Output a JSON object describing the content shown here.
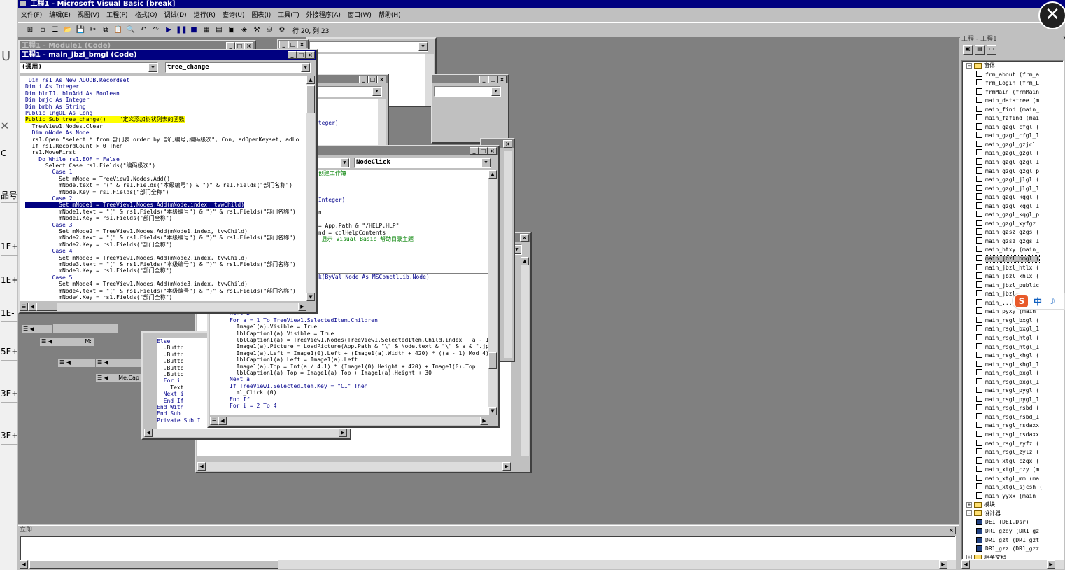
{
  "app": {
    "title": "工程1 - Microsoft Visual Basic [break]"
  },
  "menu": [
    "文件(F)",
    "编辑(E)",
    "视图(V)",
    "工程(P)",
    "格式(O)",
    "调试(D)",
    "运行(R)",
    "查询(U)",
    "图表(I)",
    "工具(T)",
    "外接程序(A)",
    "窗口(W)",
    "帮助(H)"
  ],
  "toolbar": {
    "position": "行 20, 列 23"
  },
  "module_win": {
    "title": "工程1 - Module1 (Code)"
  },
  "code_win": {
    "title": "工程1 - main_jbzl_bmgl (Code)",
    "object_combo": "(通用)",
    "proc_combo": "tree_change",
    "lines": [
      {
        "t": " Dim rs1 As New ADODB.Recordset",
        "c": "kw"
      },
      {
        "t": "Dim i As Integer",
        "c": "kw"
      },
      {
        "t": "Dim blnTJ, blnAdd As Boolean",
        "c": "kw"
      },
      {
        "t": "Dim bmjc As Integer",
        "c": "kw"
      },
      {
        "t": "Dim bmbh As String",
        "c": "kw"
      },
      {
        "t": "Public lngOL As Long",
        "c": "kw"
      },
      {
        "t": "Public Sub tree_change()    '定义添加树状列表的函数",
        "c": "hl"
      },
      {
        "t": "  TreeView1.Nodes.Clear",
        "c": ""
      },
      {
        "t": "  Dim mNode As Node",
        "c": "kw"
      },
      {
        "t": "  rs1.Open \"select * from 部门表 order by 部门编号,编码级次\", Cnn, adOpenKeyset, adLo",
        "c": ""
      },
      {
        "t": "  If rs1.RecordCount > 0 Then",
        "c": ""
      },
      {
        "t": "  rs1.MoveFirst",
        "c": ""
      },
      {
        "t": "    Do While rs1.EOF = False",
        "c": "kw"
      },
      {
        "t": "      Select Case rs1.Fields(\"编码级次\")",
        "c": ""
      },
      {
        "t": "        Case 1",
        "c": "kw"
      },
      {
        "t": "          Set mNode = TreeView1.Nodes.Add()",
        "c": ""
      },
      {
        "t": "          mNode.text = \"(\" & rs1.Fields(\"本级编号\") & \")\" & rs1.Fields(\"部门名称\")",
        "c": ""
      },
      {
        "t": "          mNode.Key = rs1.Fields(\"部门全称\")",
        "c": ""
      },
      {
        "t": "        Case 2",
        "c": "kw"
      },
      {
        "t": "          Set mNode1 = TreeView1.Nodes.Add(mNode.index, tvwChild)",
        "c": "sel"
      },
      {
        "t": "          mNode1.text = \"(\" & rs1.Fields(\"本级编号\") & \")\" & rs1.Fields(\"部门名称\")",
        "c": ""
      },
      {
        "t": "          mNode1.Key = rs1.Fields(\"部门全称\")",
        "c": ""
      },
      {
        "t": "        Case 3",
        "c": "kw"
      },
      {
        "t": "          Set mNode2 = TreeView1.Nodes.Add(mNode1.index, tvwChild)",
        "c": ""
      },
      {
        "t": "          mNode2.text = \"(\" & rs1.Fields(\"本级编号\") & \")\" & rs1.Fields(\"部门名称\")",
        "c": ""
      },
      {
        "t": "          mNode2.Key = rs1.Fields(\"部门全称\")",
        "c": ""
      },
      {
        "t": "        Case 4",
        "c": "kw"
      },
      {
        "t": "          Set mNode3 = TreeView1.Nodes.Add(mNode2.index, tvwChild)",
        "c": ""
      },
      {
        "t": "          mNode3.text = \"(\" & rs1.Fields(\"本级编号\") & \")\" & rs1.Fields(\"部门名称\")",
        "c": ""
      },
      {
        "t": "          mNode3.Key = rs1.Fields(\"部门全称\")",
        "c": ""
      },
      {
        "t": "        Case 5",
        "c": "kw"
      },
      {
        "t": "          Set mNode4 = TreeView1.Nodes.Add(mNode3.index, tvwChild)",
        "c": ""
      },
      {
        "t": "          mNode4.text = \"(\" & rs1.Fields(\"本级编号\") & \")\" & rs1.Fields(\"部门名称\")",
        "c": ""
      },
      {
        "t": "          mNode4.Key = rs1.Fields(\"部门全称\")",
        "c": ""
      }
    ]
  },
  "nodeclick_win": {
    "proc_combo": "NodeClick",
    "lines_top": [
      {
        "t": "'创建工作簿",
        "c": "cm"
      },
      {
        "t": "",
        "c": ""
      },
      {
        "t": "",
        "c": ""
      },
      {
        "t": "",
        "c": ""
      },
      {
        "t": " Integer)",
        "c": "kw"
      },
      {
        "t": "",
        "c": ""
      },
      {
        "t": "on",
        "c": ""
      },
      {
        "t": "",
        "c": ""
      },
      {
        "t": " = App.Path & \"/HELP.HLP\"",
        "c": ""
      },
      {
        "t": "and = cdlHelpContents",
        "c": ""
      },
      {
        "t": "' 显示 Visual Basic 帮助目录主题",
        "c": "cm"
      }
    ],
    "line_sig": "ck(ByVal Node As MSComctlLib.Node)",
    "lines_bottom": [
      {
        "t": "False",
        "c": "kw"
      },
      {
        "t": "\"\"",
        "c": ""
      },
      {
        "t": "Next B",
        "c": "kw"
      },
      {
        "t": "For a = 1 To TreeView1.SelectedItem.Children",
        "c": "kw"
      },
      {
        "t": "  Image1(a).Visible = True",
        "c": ""
      },
      {
        "t": "  lblCaption1(a).Visible = True",
        "c": ""
      },
      {
        "t": "  lblCaption1(a) = TreeView1.Nodes(TreeView1.SelectedItem.Child.index + a - 1).",
        "c": ""
      },
      {
        "t": "  Image1(a).Picture = LoadPicture(App.Path & \"\\\" & Node.text & \"\\\" & a & \".jpg\"",
        "c": ""
      },
      {
        "t": "  Image1(a).Left = Image1(0).Left + (Image1(a).Width + 420) * ((a - 1) Mod 4)",
        "c": ""
      },
      {
        "t": "  lblCaption1(a).Left = Image1(a).Left",
        "c": ""
      },
      {
        "t": "  Image1(a).Top = Int(a / 4.1) * (Image1(0).Height + 420) + Image1(0).Top",
        "c": ""
      },
      {
        "t": "  lblCaption1(a).Top = Image1(a).Top + Image1(a).Height + 30",
        "c": ""
      },
      {
        "t": "Next a",
        "c": "kw"
      },
      {
        "t": "If TreeView1.SelectedItem.Key = \"C1\" Then",
        "c": "kw"
      },
      {
        "t": "  ml_Click (0)",
        "c": ""
      },
      {
        "t": "End If",
        "c": "kw"
      },
      {
        "t": "For i = 2 To 4",
        "c": "kw"
      }
    ]
  },
  "snippet_win": {
    "lines": [
      "Else",
      "  .Butto",
      "  .Butto",
      "  .Butto",
      "  .Butto",
      "  .Butto",
      "  For i",
      "    Text",
      "  Next i",
      "  End If",
      "End With",
      "End Sub",
      "Private Sub I"
    ],
    "mini_labels": [
      "M:",
      "Me.Cap"
    ],
    "behind_text": "nteger)"
  },
  "immediate": {
    "title": "立即"
  },
  "left_partial": {
    "letter": "U",
    "cells": [
      "C",
      "品号",
      "1E+",
      "1E+",
      "1E-",
      "5E+",
      "3E+",
      "3E+"
    ]
  },
  "project": {
    "title": "工程 - 工程1",
    "folder_forms": "窗体",
    "forms": [
      "frm_about (frm_a",
      "frm_Login (frm_L",
      "frmMain (frmMain",
      "main_datatree (m",
      "main_find (main_",
      "main_fzfind (mai",
      "main_gzgl_cfgl (",
      "main_gzgl_cfgl_1",
      "main_gzgl_gzjcl",
      "main_gzgl_gzgl (",
      "main_gzgl_gzgl_1",
      "main_gzgl_gzgl_p",
      "main_gzgl_jlgl (",
      "main_gzgl_jlgl_1",
      "main_gzgl_kqgl (",
      "main_gzgl_kqgl_1",
      "main_gzgl_kqgl_p",
      "main_gzgl_xyfgz",
      "main_gzsz_gzgs (",
      "main_gzsz_gzgs_1",
      "main_htxy (main_",
      "main_jbzl_bmgl (",
      "main_jbzl_htlx (",
      "main_jbzl_khlx (",
      "main_jbzl_public",
      "main_jbzl_...",
      "main_...",
      "main_pyxy (main_",
      "main_rsgl_bxgl (",
      "main_rsgl_bxgl_1",
      "main_rsgl_htgl (",
      "main_rsgl_htgl_1",
      "main_rsgl_khgl (",
      "main_rsgl_khgl_1",
      "main_rsgl_pxgl (",
      "main_rsgl_pxgl_1",
      "main_rsgl_pygl (",
      "main_rsgl_pygl_1",
      "main_rsgl_rsbd (",
      "main_rsgl_rsbd_1",
      "main_rsgl_rsdaxx",
      "main_rsgl_rsdaxx",
      "main_rsgl_zyfz (",
      "main_rsgl_zylz (",
      "main_xtgl_czqx (",
      "main_xtgl_czy (m",
      "main_xtgl_mm (ma",
      "main_xtgl_sjcsh (",
      "main_yyxx (main_"
    ],
    "folder_modules": "模块",
    "folder_designers": "设计器",
    "designers": [
      "DE1 (DE1.Dsr)",
      "DR1_gzdy (DR1_gz",
      "DR1_gzt (DR1_gzt",
      "DR1_gzz (DR1_gzz"
    ],
    "folder_docs": "相关文档"
  },
  "ime": {
    "logo": "S",
    "mode": "中",
    "moon": "☽"
  },
  "close_overlay": "✕",
  "colors": {
    "title_active": "#000080",
    "title_inactive": "#808080",
    "face": "#c0c0c0",
    "desktop": "#808080"
  }
}
